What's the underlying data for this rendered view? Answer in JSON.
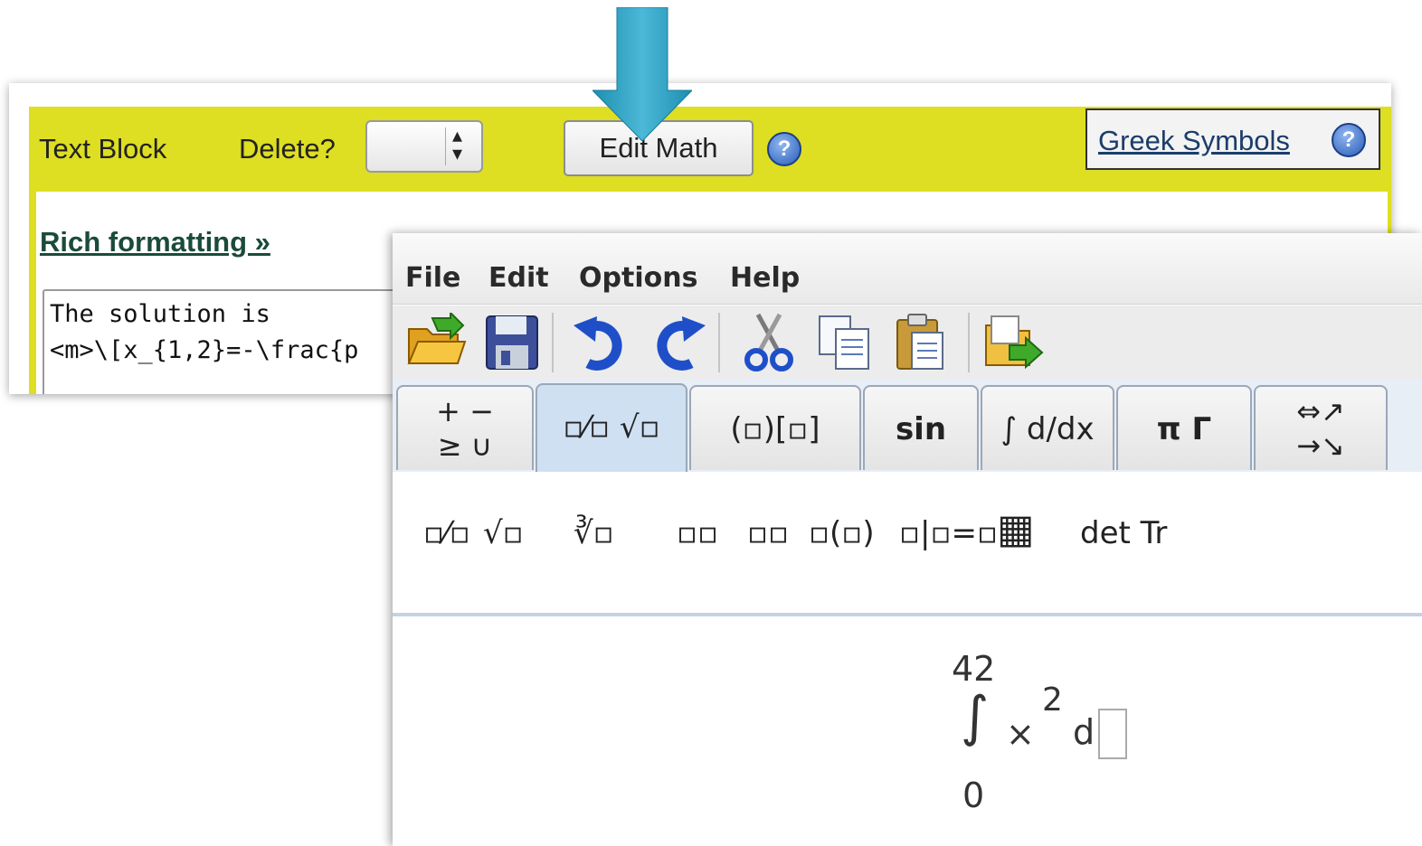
{
  "form": {
    "block_label": "Text Block",
    "delete_label": "Delete?",
    "delete_select_value": "",
    "edit_math_button": "Edit Math",
    "help_icon": "?",
    "greek_link": "Greek Symbols",
    "rich_formatting_link": "Rich formatting »",
    "source_text": "The solution is\n<m>\\[x_{1,2}=-\\frac{p"
  },
  "editor": {
    "menu": [
      "File",
      "Edit",
      "Options",
      "Help"
    ],
    "toolbar_icons": [
      "open-folder-icon",
      "save-icon",
      "undo-icon",
      "redo-icon",
      "cut-icon",
      "copy-icon",
      "paste-icon",
      "export-icon"
    ],
    "tabs": [
      {
        "name": "tab-operators",
        "glyph": "+ −\n≥ ∪"
      },
      {
        "name": "tab-fractions-roots",
        "glyph": "▫⁄▫ √▫"
      },
      {
        "name": "tab-brackets",
        "glyph": "(▫)[▫]"
      },
      {
        "name": "tab-functions",
        "glyph": "sin"
      },
      {
        "name": "tab-calculus",
        "glyph": "∫ d/dx"
      },
      {
        "name": "tab-greek",
        "glyph": "π Γ"
      },
      {
        "name": "tab-arrows",
        "glyph": "⇔↗\n→↘"
      }
    ],
    "palette": [
      {
        "name": "fraction-template",
        "glyph": "▫⁄▫"
      },
      {
        "name": "sqrt-template",
        "glyph": "√▫"
      },
      {
        "name": "nth-root-template",
        "glyph": "∛▫"
      },
      {
        "name": "superscript-template",
        "glyph": "▫▫"
      },
      {
        "name": "subscript-template",
        "glyph": "▫▫"
      },
      {
        "name": "function-template",
        "glyph": "▫(▫)"
      },
      {
        "name": "evaluate-template",
        "glyph": "▫|▫=▫"
      },
      {
        "name": "matrix-template",
        "glyph": "▦"
      },
      {
        "name": "determinant-trace",
        "glyph": "det Tr"
      }
    ],
    "expression": {
      "upper_limit": "42",
      "integral": "∫",
      "times": "×",
      "exponent": "2",
      "differential": "d",
      "lower_limit": "0"
    }
  }
}
